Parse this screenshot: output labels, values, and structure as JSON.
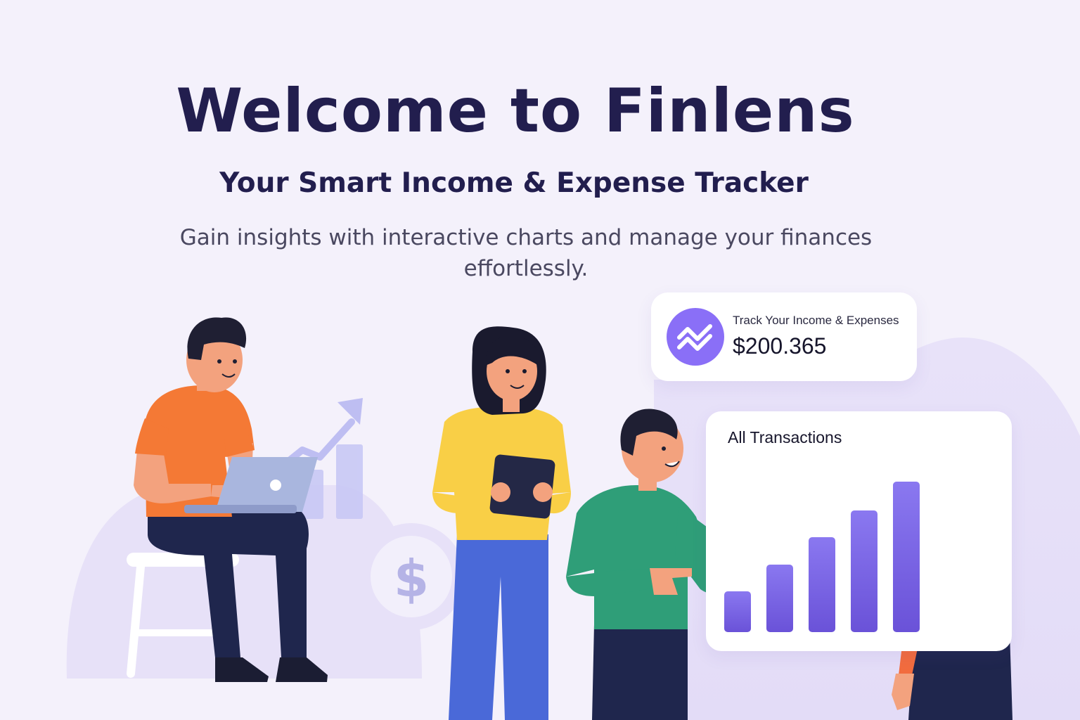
{
  "hero": {
    "title": "Welcome to Finlens",
    "subtitle": "Your Smart Income & Expense Tracker",
    "description": "Gain insights with interactive charts and manage your finances effortlessly."
  },
  "stat_card": {
    "icon": "trend-chart-icon",
    "label": "Track Your Income & Expenses",
    "value": "$200.365"
  },
  "transactions_card": {
    "title": "All Transactions",
    "bar_levels": [
      0.27,
      0.45,
      0.63,
      0.81,
      1.0
    ]
  },
  "illustration": {
    "currency_symbol": "$"
  },
  "colors": {
    "background": "#f4f1fb",
    "heading": "#221e4e",
    "accent": "#8a6ff7",
    "bar_top": "#8a78f0",
    "bar_bottom": "#6a52d8"
  }
}
